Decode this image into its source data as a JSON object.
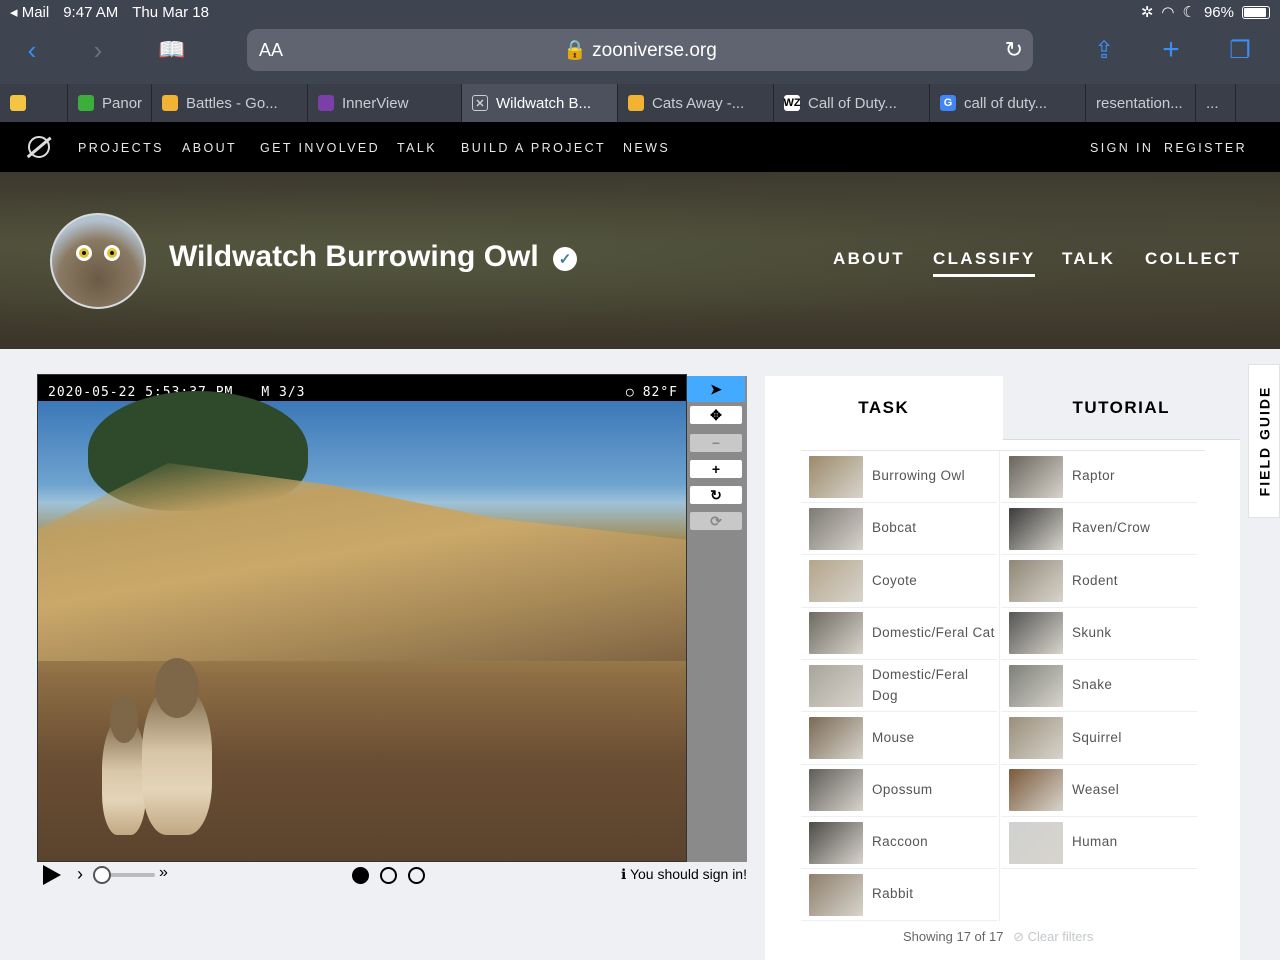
{
  "status_bar": {
    "back_app": "Mail",
    "time": "9:47 AM",
    "date": "Thu Mar 18",
    "battery": "96%",
    "battery_level": 0.96
  },
  "browser": {
    "aa": "AA",
    "url": "zooniverse.org"
  },
  "tabs": [
    {
      "label": "",
      "icon": "ring-favicon",
      "color": "#f4c542"
    },
    {
      "label": "Panor",
      "icon": "green-ball-favicon",
      "color": "#3cae3c"
    },
    {
      "label": "Battles - Go...",
      "icon": "hand-emoji-favicon",
      "color": "#f2b233"
    },
    {
      "label": "InnerView",
      "icon": "innerview-favicon",
      "color": "#7a3fa8"
    },
    {
      "label": "Wildwatch B...",
      "icon": "close-icon",
      "color": "#cccccc"
    },
    {
      "label": "Cats Away -...",
      "icon": "hand-emoji-favicon",
      "color": "#f2b233"
    },
    {
      "label": "Call of Duty...",
      "icon": "wz-favicon",
      "color": "#ffffff"
    },
    {
      "label": "call of duty...",
      "icon": "google-favicon",
      "color": "#4285f4"
    },
    {
      "label": "resentation...",
      "icon": "",
      "color": ""
    },
    {
      "label": "...",
      "icon": "",
      "color": ""
    }
  ],
  "zoo_nav": {
    "items": [
      "PROJECTS",
      "ABOUT",
      "GET INVOLVED",
      "TALK",
      "BUILD A PROJECT",
      "NEWS"
    ],
    "sign_in": "SIGN IN",
    "register": "REGISTER"
  },
  "project": {
    "title": "Wildwatch Burrowing Owl",
    "nav": [
      "ABOUT",
      "CLASSIFY",
      "TALK",
      "COLLECT"
    ],
    "active_nav": "CLASSIFY"
  },
  "viewer": {
    "stamp_datetime": "2020-05-22 5:53:37 PM",
    "stamp_mode": "M 3/3",
    "stamp_temp": "82°F",
    "sign_in_notice": "You should sign in!",
    "frames": 3,
    "current_frame": 1
  },
  "task": {
    "tab_task": "TASK",
    "tab_tutorial": "TUTORIAL",
    "choices_left": [
      {
        "label": "Burrowing Owl",
        "color": "#9c8a6a"
      },
      {
        "label": "Bobcat",
        "color": "#7d7a74"
      },
      {
        "label": "Coyote",
        "color": "#b3a58a"
      },
      {
        "label": "Domestic/Feral Cat",
        "color": "#6f6a60"
      },
      {
        "label": "Domestic/Feral Dog",
        "color": "#a9a49a"
      },
      {
        "label": "Mouse",
        "color": "#7a6a55"
      },
      {
        "label": "Opossum",
        "color": "#5f5d58"
      },
      {
        "label": "Raccoon",
        "color": "#4d4b48"
      },
      {
        "label": "Rabbit",
        "color": "#8d7f6b"
      }
    ],
    "choices_right": [
      {
        "label": "Raptor",
        "color": "#6a655c"
      },
      {
        "label": "Raven/Crow",
        "color": "#3b3b3b"
      },
      {
        "label": "Rodent",
        "color": "#908676"
      },
      {
        "label": "Skunk",
        "color": "#555555"
      },
      {
        "label": "Snake",
        "color": "#7d8078"
      },
      {
        "label": "Squirrel",
        "color": "#9a8e7a"
      },
      {
        "label": "Weasel",
        "color": "#7a5a3a"
      },
      {
        "label": "Human",
        "color": "#cfd1d0"
      }
    ],
    "showing": "Showing 17 of 17",
    "clear_filters": "Clear filters"
  },
  "field_guide": "FIELD GUIDE",
  "colors": {
    "accent": "#3b8ef5",
    "zoo_teal": "#00979d",
    "tool_selected": "#44aaff"
  }
}
